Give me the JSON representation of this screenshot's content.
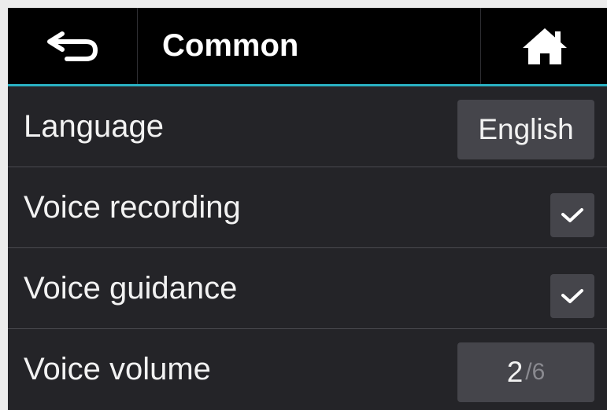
{
  "header": {
    "back_icon": "back-arrow-icon",
    "title": "Common",
    "home_icon": "home-icon"
  },
  "settings": [
    {
      "label": "Language",
      "control": "button",
      "value": "English"
    },
    {
      "label": "Voice recording",
      "control": "checkbox",
      "checked": true
    },
    {
      "label": "Voice guidance",
      "control": "checkbox",
      "checked": true
    },
    {
      "label": "Voice volume",
      "control": "stepper",
      "value": "2",
      "total": "/6"
    }
  ],
  "colors": {
    "header_bg": "#000000",
    "accent_line": "#2ab0c2",
    "panel_bg": "#242428",
    "control_bg": "#45454b",
    "text": "#f2f2f2",
    "muted_text": "#8a8a90"
  }
}
